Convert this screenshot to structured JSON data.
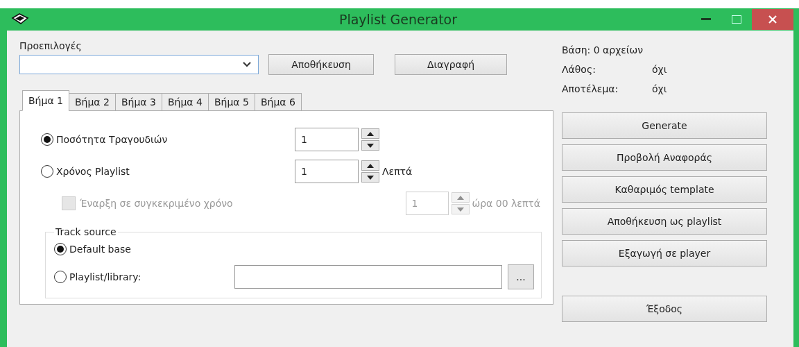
{
  "window": {
    "title": "Playlist Generator"
  },
  "presets": {
    "label": "Προεπιλογές",
    "buttons": [
      "Αποθήκευση",
      "Διαγραφή"
    ]
  },
  "tabs": [
    {
      "label": "Βήμα 1",
      "selected": true
    },
    {
      "label": "Βήμα 2",
      "selected": false
    },
    {
      "label": "Βήμα 3",
      "selected": false
    },
    {
      "label": "Βήμα 4",
      "selected": false
    },
    {
      "label": "Βήμα 5",
      "selected": false
    },
    {
      "label": "Βήμα 6",
      "selected": false
    }
  ],
  "step": {
    "modes": [
      {
        "label": "Ποσότητα Τραγουδιών",
        "selected": true,
        "value": "1"
      },
      {
        "label": "Χρόνος Playlist",
        "selected": false,
        "value": "1",
        "unit": "Λεπτά"
      }
    ],
    "start_time": {
      "label": "Έναρξη σε συγκεκριμένο χρόνο",
      "checked": false,
      "disabled": true,
      "value": "1",
      "unit": "ώρα 00 λεπτά"
    },
    "track_source": {
      "title": "Track source",
      "options": [
        {
          "kind": "plain",
          "label": "Default base",
          "selected": true
        },
        {
          "kind": "path",
          "label": "Playlist/library:",
          "selected": false,
          "browse": "..."
        }
      ]
    }
  },
  "status": {
    "database": "Βάση: 0 αρχείων",
    "rows": [
      {
        "label": "Λάθος:",
        "value": "όχι"
      },
      {
        "label": "Αποτέλεμα:",
        "value": "όχι"
      }
    ]
  },
  "actions": [
    "Generate",
    "Προβολή Αναφοράς",
    "Καθαριμός template",
    "Αποθήκευση ως playlist",
    "Εξαγωγή σε player"
  ],
  "exit": "Έξοδος"
}
